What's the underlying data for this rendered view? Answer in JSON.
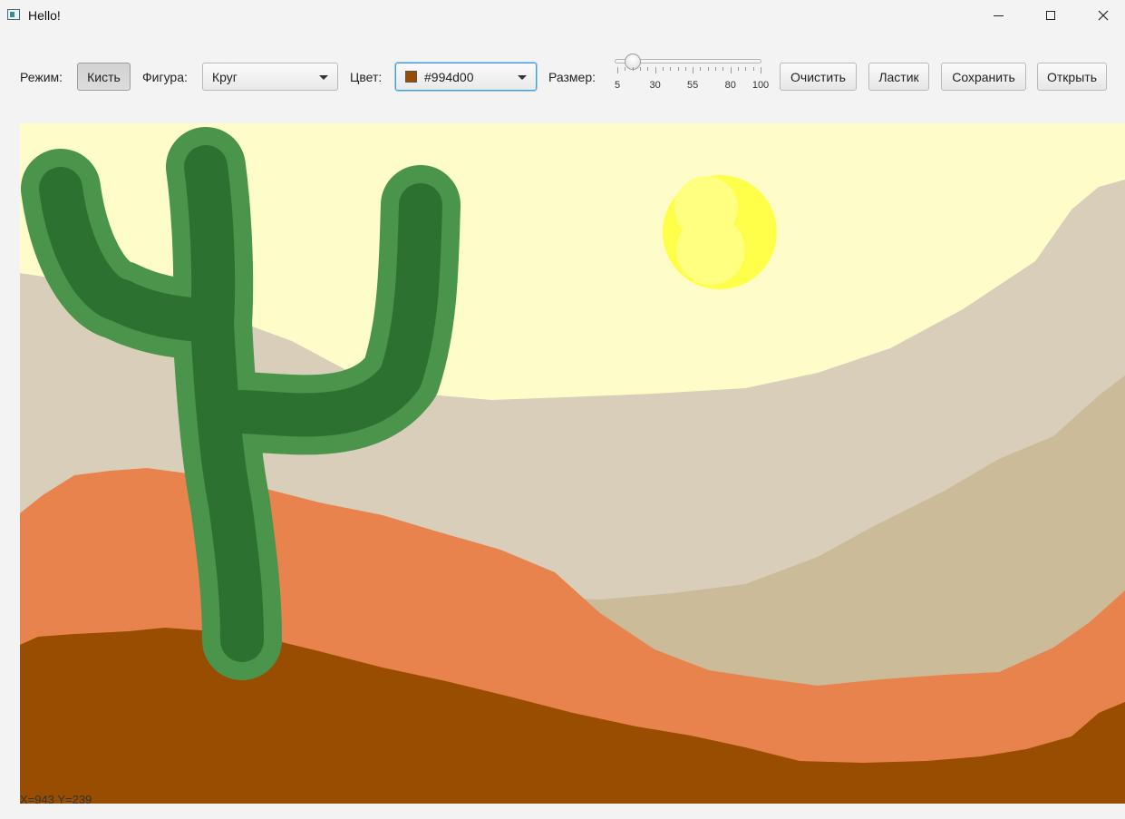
{
  "window": {
    "title": "Hello!"
  },
  "toolbar": {
    "mode_label": "Режим:",
    "mode_button": "Кисть",
    "shape_label": "Фигура:",
    "shape_value": "Круг",
    "color_label": "Цвет:",
    "color_value": "#994d00",
    "color_swatch": "#994d00",
    "size_label": "Размер:",
    "size_value": 15,
    "size_min": 5,
    "size_max": 100,
    "size_ticks": [
      "5",
      "30",
      "55",
      "80",
      "100"
    ],
    "clear_button": "Очистить",
    "eraser_button": "Ластик",
    "save_button": "Сохранить",
    "open_button": "Открыть"
  },
  "canvas": {
    "colors": {
      "sky": "#fefdca",
      "far_hill": "#d9ceb9",
      "mid_hill": "#ccbb99",
      "orange_dune": "#e8834d",
      "ground": "#994d00",
      "cactus_outer": "#4b944b",
      "cactus_inner": "#2d7130",
      "sun": "#ffff49",
      "sun_highlight": "#ffff80"
    }
  },
  "status": {
    "coordinates": "X=943 Y=239"
  }
}
